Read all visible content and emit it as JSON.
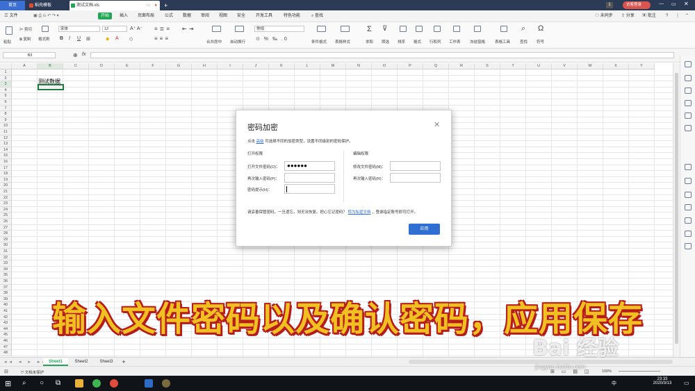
{
  "titlebar": {
    "tabs": [
      {
        "label": "首页"
      },
      {
        "label": "稻壳模板"
      },
      {
        "label": "测试文档.xls"
      }
    ],
    "badge": "1",
    "login": "访客登录",
    "accent": "#2b3a55"
  },
  "menubar": {
    "file": "三 文件",
    "items": [
      "开始",
      "插入",
      "页面布局",
      "公式",
      "数据",
      "审阅",
      "视图",
      "安全",
      "开发工具",
      "特色功能"
    ],
    "search": "查找",
    "sync": "未同步",
    "share": "分享",
    "comment": "批注"
  },
  "ribbon": {
    "cut": "剪切",
    "copy": "复制",
    "paste": "粘贴",
    "format_painter": "格式刷",
    "font": "宋体",
    "size": "12",
    "merge": "合并居中",
    "wrap": "自动换行",
    "numfmt": "常规",
    "cond": "条件格式",
    "table_style": "表格样式",
    "sum": "求和",
    "filter": "筛选",
    "sort": "排序",
    "format": "格式",
    "rowcol": "行和列",
    "sheet": "工作表",
    "freeze": "冻结窗格",
    "tools": "表格工具",
    "find": "查找",
    "symbol": "符号"
  },
  "formula": {
    "cellref": "B3",
    "fx": "fx"
  },
  "grid": {
    "columns": [
      "A",
      "B",
      "C",
      "D",
      "E",
      "F",
      "G",
      "H",
      "I",
      "J",
      "K",
      "L",
      "M",
      "N",
      "O",
      "P",
      "Q",
      "R",
      "S",
      "T",
      "U",
      "V",
      "W",
      "X",
      "Y"
    ],
    "rows": [
      "1",
      "2",
      "3",
      "4",
      "5",
      "6",
      "7",
      "8",
      "9",
      "10",
      "11",
      "12",
      "13",
      "14",
      "15",
      "16",
      "17",
      "18",
      "19",
      "20",
      "21",
      "22",
      "23",
      "24",
      "25",
      "26",
      "27",
      "28",
      "29",
      "30",
      "31",
      "32",
      "33",
      "34",
      "35",
      "36",
      "37",
      "38",
      "39",
      "40",
      "41",
      "42",
      "43",
      "44",
      "45",
      "46",
      "47",
      "48"
    ],
    "cell_b2": "测试数据"
  },
  "dialog": {
    "title": "密码加密",
    "hint_prefix": "点击",
    "hint_link": "高级",
    "hint_suffix": "可选择不同的加密类型，设置不同级别的密码保护。",
    "open_section": "打开权限",
    "edit_section": "编辑权限",
    "open_pwd_label": "打开文件密码(O)：",
    "open_pwd_value": "●●●●●●",
    "open_confirm_label": "再次输入密码(P)：",
    "hint_label": "密码提示(H)：",
    "edit_pwd_label": "修改文件密码(M)：",
    "edit_confirm_label": "再次输入密码(R)：",
    "warning_prefix": "请妥善保管密码，一旦遗忘，则无法恢复。担心忘记密码？",
    "warning_link": "转为私密文档",
    "warning_suffix": "，登录指定账号即可打开。",
    "apply": "应用"
  },
  "sheets": {
    "tabs": [
      "Sheet1",
      "Sheet2",
      "Sheet3"
    ],
    "add": "+"
  },
  "status": {
    "protect": "文档未保护",
    "zoom": "100%"
  },
  "taskbar": {
    "time": "23:33",
    "date": "2020/3/13",
    "ime": "中"
  },
  "overlay": {
    "caption": "输入文件密码以及确认密码，应用保存"
  },
  "watermark": {
    "brand": "Bai 经验",
    "url": "jingyan.baidu.com"
  }
}
